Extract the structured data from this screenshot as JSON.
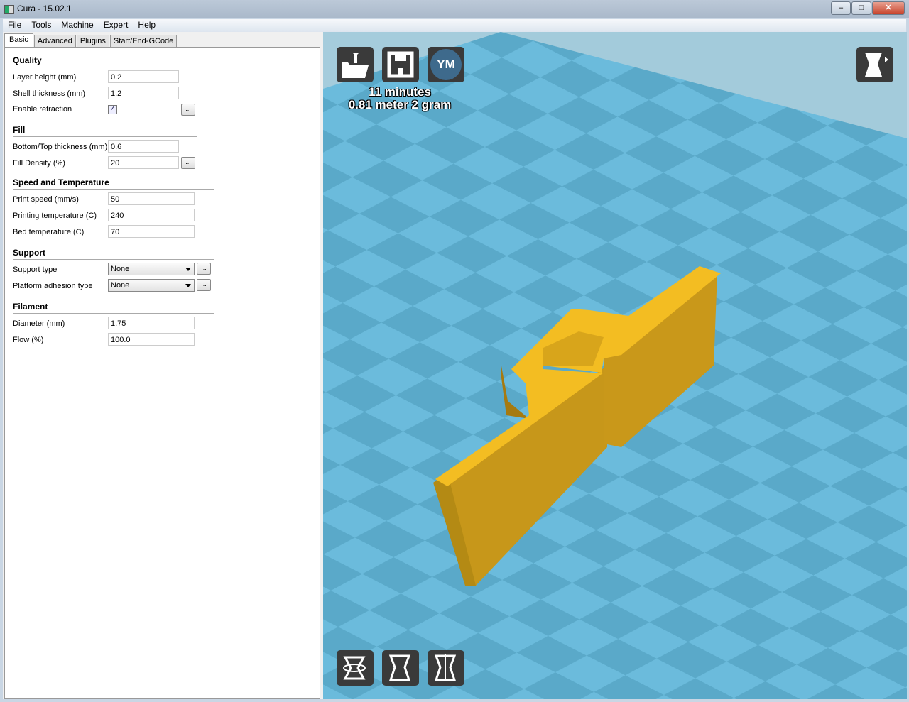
{
  "window": {
    "title": "Cura - 15.02.1",
    "minimize": "‒",
    "maximize": "□",
    "close": "✕"
  },
  "menu": [
    "File",
    "Tools",
    "Machine",
    "Expert",
    "Help"
  ],
  "tabs": [
    "Basic",
    "Advanced",
    "Plugins",
    "Start/End-GCode"
  ],
  "sections": {
    "quality": {
      "title": "Quality",
      "layer_height_label": "Layer height (mm)",
      "layer_height": "0.2",
      "shell_label": "Shell thickness (mm)",
      "shell": "1.2",
      "retraction_label": "Enable retraction",
      "retraction_checked": true
    },
    "fill": {
      "title": "Fill",
      "bottom_top_label": "Bottom/Top thickness (mm)",
      "bottom_top": "0.6",
      "density_label": "Fill Density (%)",
      "density": "20"
    },
    "speed": {
      "title": "Speed and Temperature",
      "print_speed_label": "Print speed (mm/s)",
      "print_speed": "50",
      "print_temp_label": "Printing temperature (C)",
      "print_temp": "240",
      "bed_temp_label": "Bed temperature (C)",
      "bed_temp": "70"
    },
    "support": {
      "title": "Support",
      "support_type_label": "Support type",
      "support_type": "None",
      "adhesion_label": "Platform adhesion type",
      "adhesion": "None"
    },
    "filament": {
      "title": "Filament",
      "diameter_label": "Diameter (mm)",
      "diameter": "1.75",
      "flow_label": "Flow (%)",
      "flow": "100.0"
    }
  },
  "dots_label": "...",
  "viewer": {
    "print_time": "11 minutes",
    "material": "0.81 meter 2 gram",
    "ym_label": "YM",
    "colors": {
      "model": "#f4bd20",
      "bed_light": "#6bbbdc",
      "bed_dark": "#5aa9c9"
    }
  }
}
